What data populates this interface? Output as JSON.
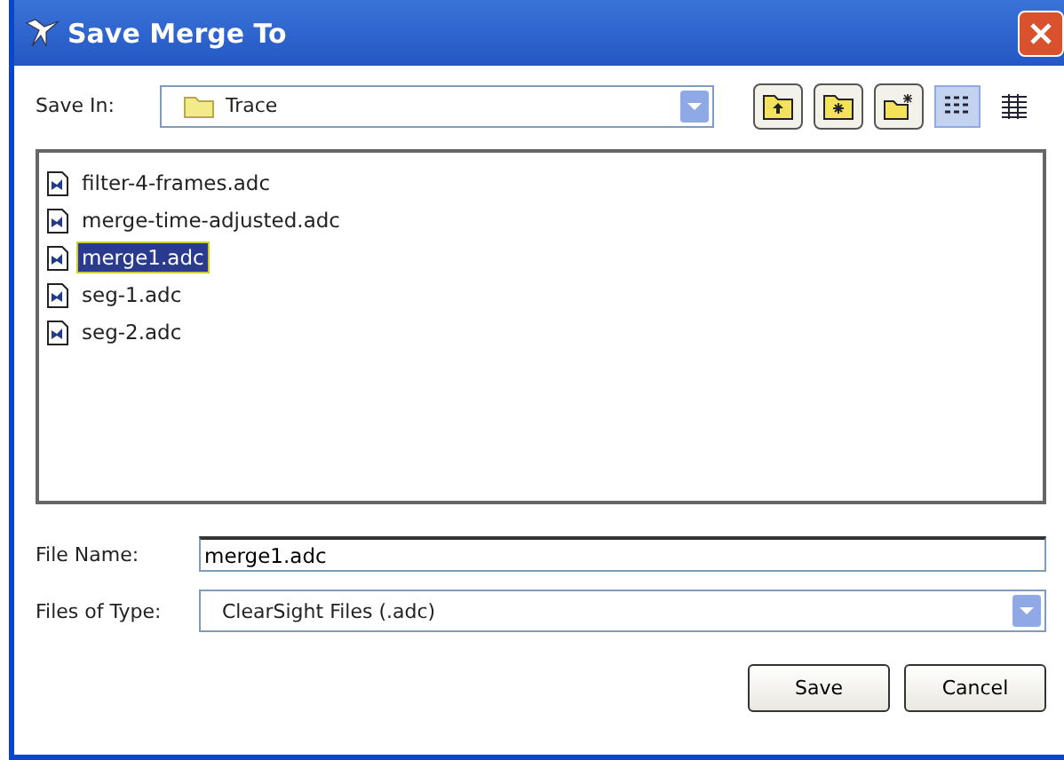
{
  "window": {
    "title": "Save Merge To"
  },
  "save_in": {
    "label": "Save In:",
    "value": "Trace"
  },
  "view_buttons": [
    {
      "kind": "list",
      "selected": true
    },
    {
      "kind": "details",
      "selected": false
    }
  ],
  "files": [
    {
      "name": "filter-4-frames.adc",
      "selected": false
    },
    {
      "name": "merge-time-adjusted.adc",
      "selected": false
    },
    {
      "name": "merge1.adc",
      "selected": true
    },
    {
      "name": "seg-1.adc",
      "selected": false
    },
    {
      "name": "seg-2.adc",
      "selected": false
    }
  ],
  "file_name": {
    "label": "File Name:",
    "value": "merge1.adc"
  },
  "file_type": {
    "label": "Files of Type:",
    "value": "ClearSight Files (.adc)"
  },
  "buttons": [
    "Save",
    "Cancel"
  ]
}
